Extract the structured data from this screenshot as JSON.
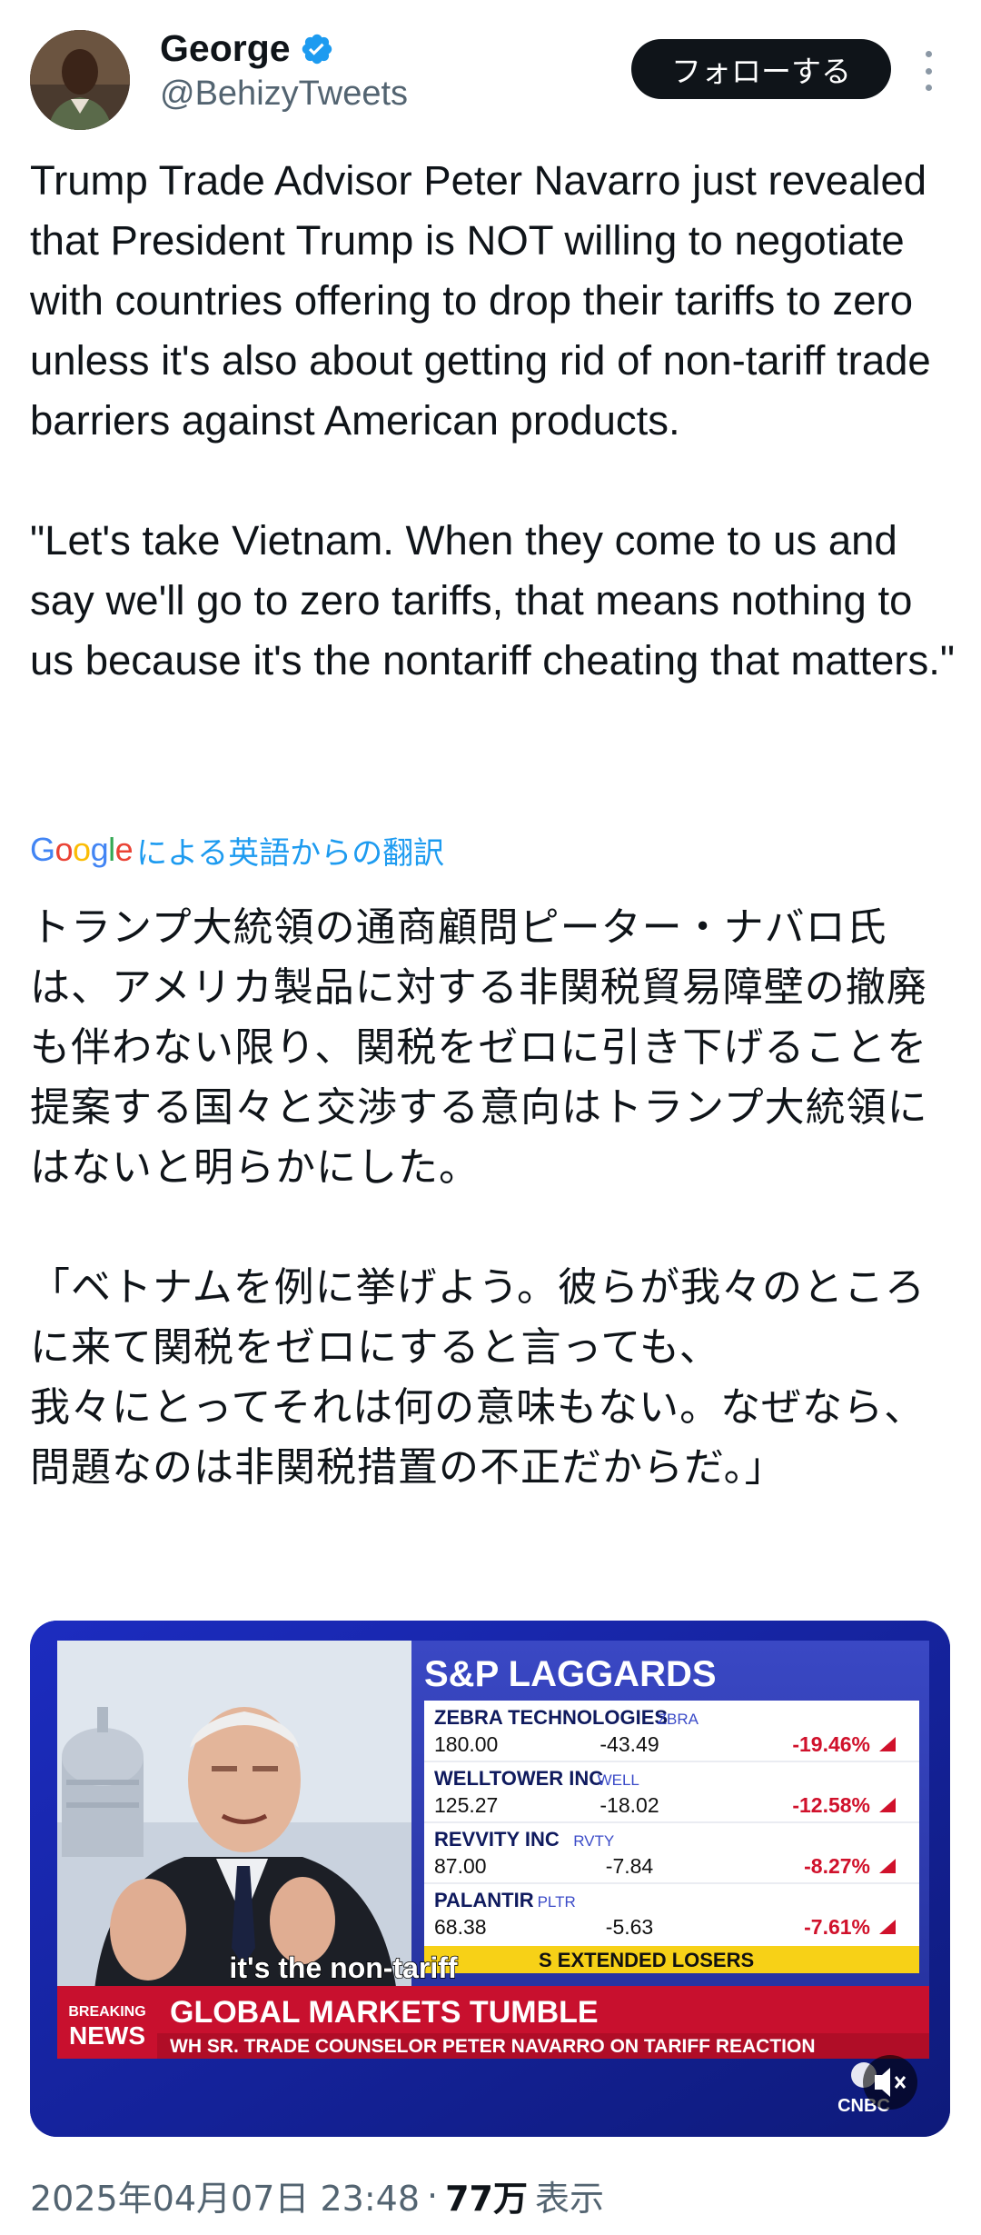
{
  "author": {
    "name": "George",
    "handle": "@BehizyTweets",
    "follow_label": "フォローする",
    "verified_icon": "verified-badge-icon",
    "more_icon": "more-options-icon"
  },
  "tweet": {
    "text_en": "Trump Trade Advisor Peter Navarro just revealed that President Trump is NOT willing to negotiate with countries offering to drop their tariffs to zero unless it's also about getting rid of non-tariff trade barriers against American products.\n\n\"Let's take Vietnam. When they come to us and say we'll go to zero tariffs, that means nothing to us because it's the nontariff cheating that matters.\"",
    "translation_brand": "Google",
    "translation_label": "による英語からの翻訳",
    "text_ja": "トランプ大統領の通商顧問ピーター・ナバロ氏は、アメリカ製品に対する非関税貿易障壁の撤廃も伴わない限り、関税をゼロに引き下げることを提案する国々と交渉する意向はトランプ大統領にはないと明らかにした。\n\n「ベトナムを例に挙げよう。彼らが我々のところに来て関税をゼロにすると言っても、\n我々にとってそれは何の意味もない。なぜなら、問題なのは非関税措置の不正だからだ。」"
  },
  "media": {
    "board_title": "S&P LAGGARDS",
    "stocks": [
      {
        "name": "ZEBRA TECHNOLOGIES",
        "ticker": "ZBRA",
        "price": "180.00",
        "change": "-43.49",
        "pct": "-19.46%"
      },
      {
        "name": "WELLTOWER INC",
        "ticker": "WELL",
        "price": "125.27",
        "change": "-18.02",
        "pct": "-12.58%"
      },
      {
        "name": "REVVITY INC",
        "ticker": "RVTY",
        "price": "87.00",
        "change": "-7.84",
        "pct": "-8.27%"
      },
      {
        "name": "PALANTIR",
        "ticker": "PLTR",
        "price": "68.38",
        "change": "-5.63",
        "pct": "-7.61%"
      }
    ],
    "ticker_strip": "S EXTENDED LOSERS",
    "caption": "it's the non-tariff",
    "breaking_top": "BREAKING",
    "breaking_bottom": "NEWS",
    "headline": "GLOBAL MARKETS TUMBLE",
    "subheadline": "WH SR. TRADE COUNSELOR PETER NAVARRO ON TARIFF REACTION",
    "network": "CNBC",
    "mute_icon": "mute-icon",
    "colors": {
      "board_bg": "#2b37a8",
      "yellow": "#f7d117",
      "red": "#c8102e",
      "down": "#d0112b"
    }
  },
  "meta": {
    "timestamp": "2025年04月07日 23:48",
    "separator": "·",
    "views": "77万",
    "views_label": "表示"
  }
}
